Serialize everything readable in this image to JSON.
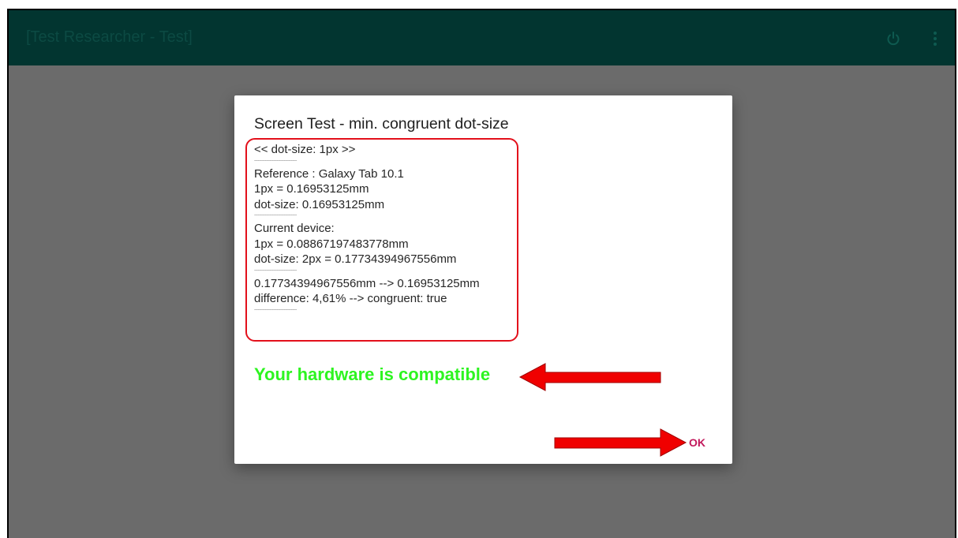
{
  "appbar": {
    "title": "[Test Researcher  - Test]",
    "icons": [
      "power-icon",
      "more-vert-icon"
    ],
    "background": "#023530"
  },
  "dialog": {
    "title": "Screen Test - min. congruent dot-size",
    "info_lines": [
      {
        "type": "text",
        "text": "<< dot-size: 1px >>"
      },
      {
        "type": "sep",
        "text": "------------------------------------"
      },
      {
        "type": "text",
        "text": "Reference : Galaxy Tab 10.1"
      },
      {
        "type": "text",
        "text": "1px = 0.16953125mm"
      },
      {
        "type": "text",
        "text": "dot-size: 0.16953125mm"
      },
      {
        "type": "sep",
        "text": "------------------------------------"
      },
      {
        "type": "text",
        "text": "Current device:"
      },
      {
        "type": "text",
        "text": "1px = 0.08867197483778mm"
      },
      {
        "type": "text",
        "text": "dot-size: 2px = 0.17734394967556mm"
      },
      {
        "type": "sep",
        "text": "------------------------------------"
      },
      {
        "type": "text",
        "text": "0.17734394967556mm --> 0.16953125mm"
      },
      {
        "type": "text",
        "text": "difference: 4,61% --> congruent: true"
      },
      {
        "type": "sep",
        "text": "------------------------------------"
      }
    ],
    "compatibility_message": "Your hardware is compatible",
    "ok_label": "OK"
  },
  "colors": {
    "overlay": "#6b6b6b",
    "highlight": "#e3101b",
    "success_text": "#2ef421",
    "ok_text": "#c2185b"
  }
}
